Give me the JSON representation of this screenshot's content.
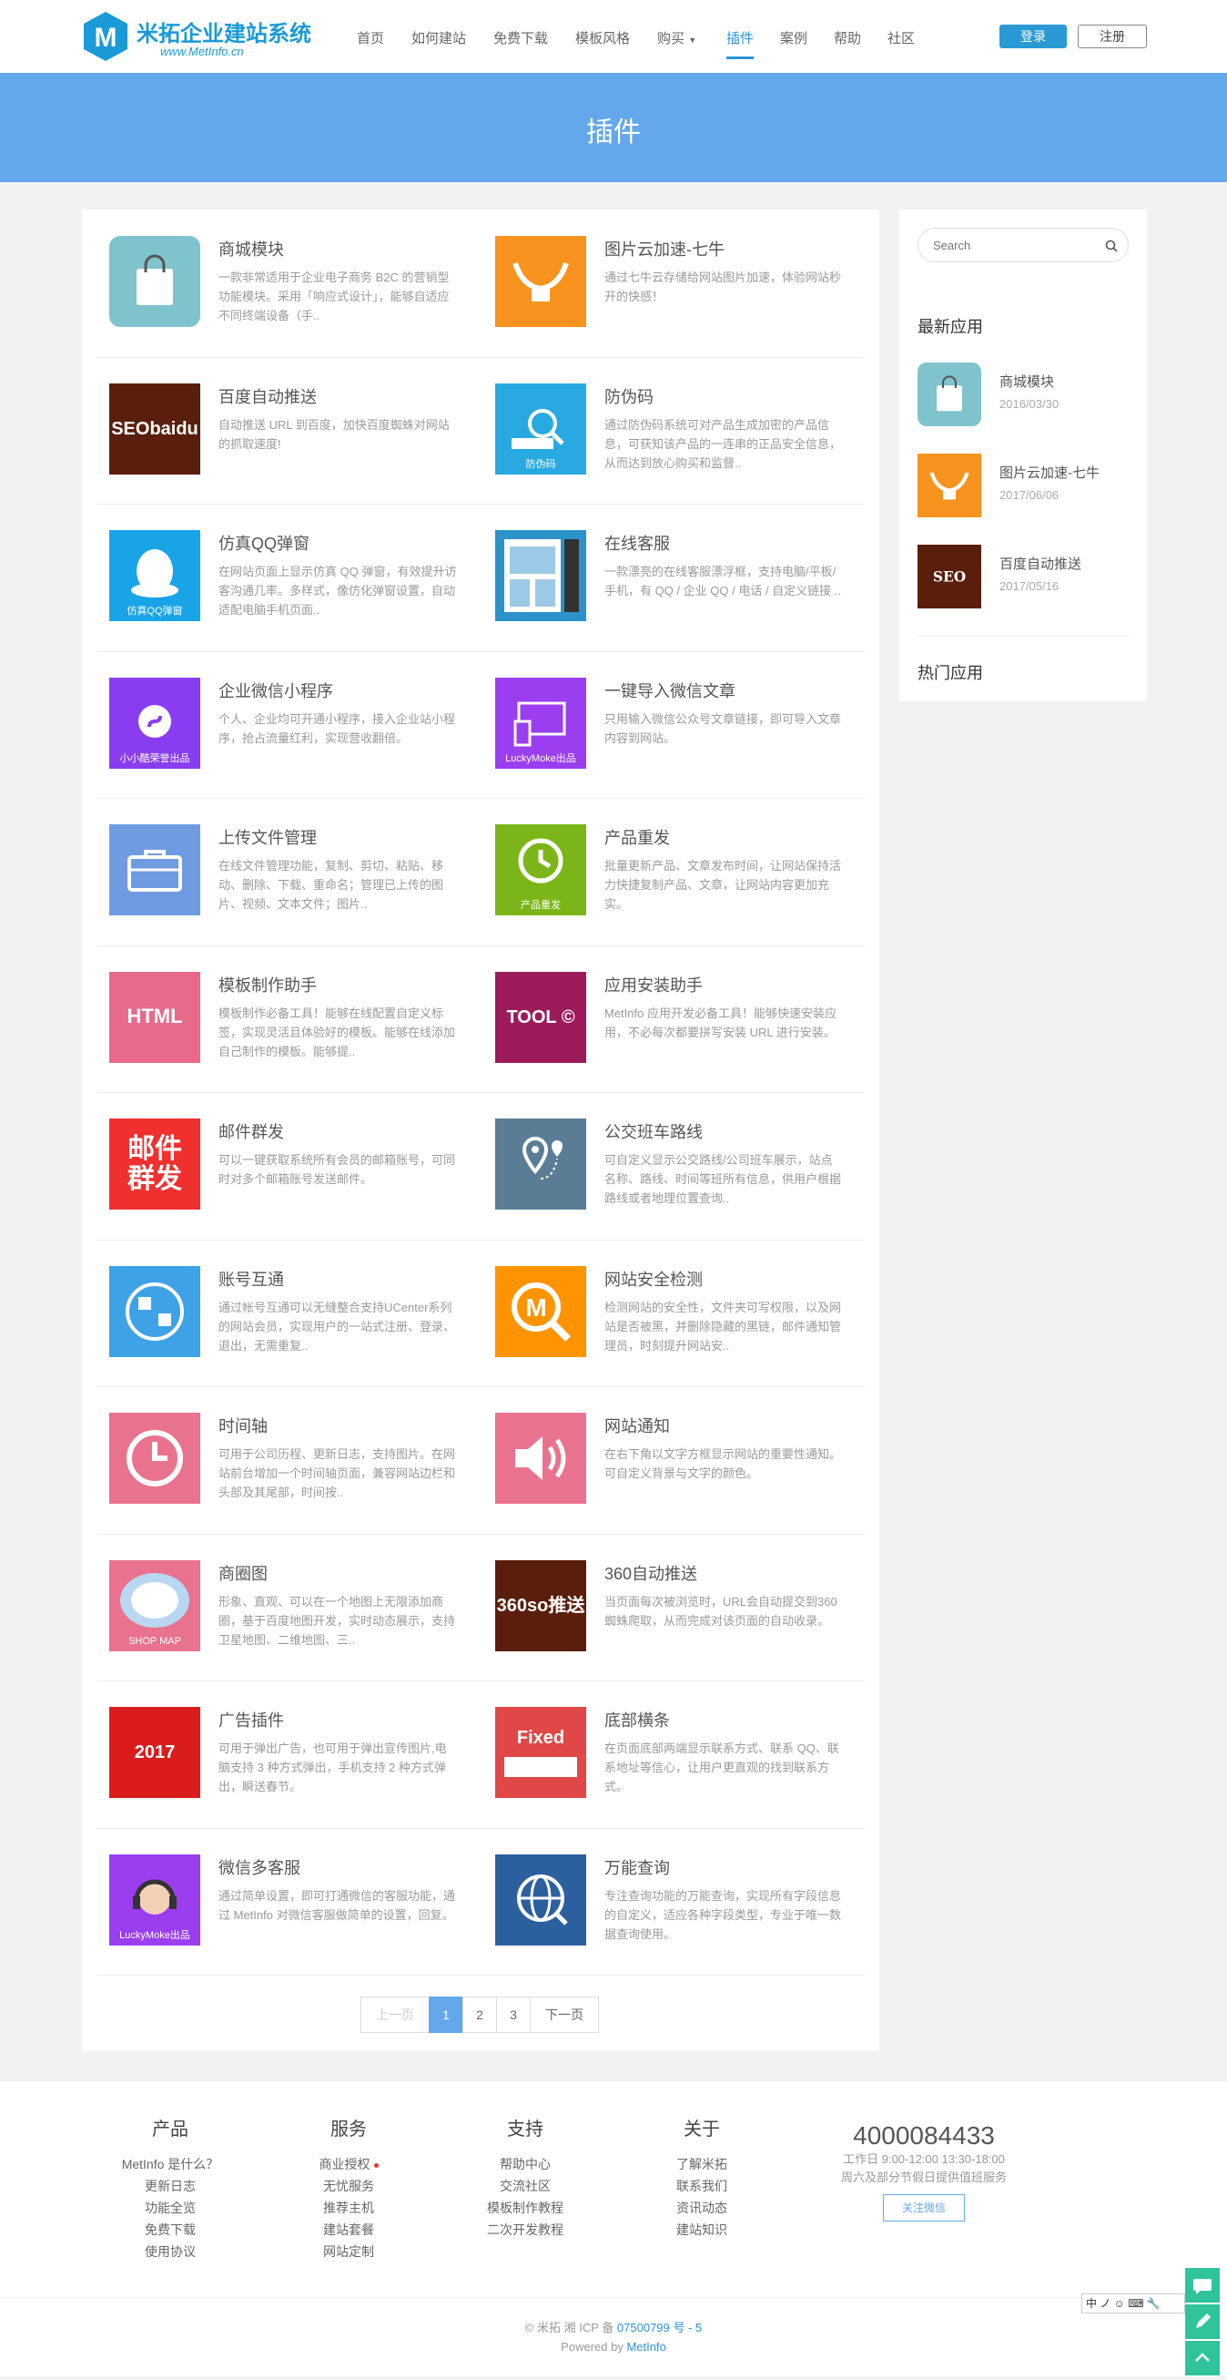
{
  "brand": {
    "name": "米拓企业建站系统",
    "url": "www.MetInfo.cn",
    "accent": "#2a93d5",
    "banner_color": "#62a8ea"
  },
  "nav": {
    "items": [
      "首页",
      "如何建站",
      "免费下载",
      "模板风格",
      "购买",
      "插件",
      "案例",
      "帮助",
      "社区"
    ],
    "active": "插件",
    "login": "登录",
    "register": "注册"
  },
  "banner": {
    "title": "插件"
  },
  "plugins": [
    {
      "title": "商城模块",
      "desc": "一款非常适用于企业电子商务 B2C 的营销型功能模块。采用「响应式设计」，能够自适应不同终端设备（手..",
      "icon": "shopping-bag-icon",
      "color": "#7fc3cc"
    },
    {
      "title": "图片云加速-七牛",
      "desc": "通过七牛云存储给网站图片加速，体验网站秒开的快感！",
      "icon": "qiniu-icon",
      "color": "#f7931e"
    },
    {
      "title": "百度自动推送",
      "desc": "自动推送 URL 到百度，加快百度蜘蛛对网站的抓取速度!",
      "icon": "seo-baidu-icon",
      "color": "#5a1e0c",
      "text": "SEObaidu"
    },
    {
      "title": "防伪码",
      "desc": "通过防伪码系统可对产品生成加密的产品信息，可获知该产品的一连串的正品安全信息，从而达到放心购买和监督..",
      "icon": "search-code-icon",
      "color": "#29a9e1",
      "text": "防伪码"
    },
    {
      "title": "仿真QQ弹窗",
      "desc": "在网站页面上显示仿真 QQ 弹窗，有效提升访客沟通几率。多样式，像仿化弹窗设置，自动适配电脑手机页面..",
      "icon": "qq-penguin-icon",
      "color": "#1aa4e8",
      "text": "仿真QQ弹窗"
    },
    {
      "title": "在线客服",
      "desc": "一款漂亮的在线客服漂浮框，支持电脑/平板/手机，有 QQ / 企业 QQ / 电话 / 自定义链接 ..",
      "icon": "online-service-icon",
      "color": "#2b93c9"
    },
    {
      "title": "企业微信小程序",
      "desc": "个人、企业均可开通小程序，接入企业站小程序，抢占流量红利，实现营收翻倍。",
      "icon": "mini-program-icon",
      "color": "#8a3df0",
      "text": "小小酷荣誉出品"
    },
    {
      "title": "一键导入微信文章",
      "desc": "只用输入微信公众号文章链接，即可导入文章内容到网站。",
      "icon": "devices-icon",
      "color": "#9b3ef0",
      "text": "LuckyMoke出品"
    },
    {
      "title": "上传文件管理",
      "desc": "在线文件管理功能，复制、剪切、粘贴、移动、删除、下载、重命名；管理已上传的图片、视频、文本文件；图片..",
      "icon": "briefcase-icon",
      "color": "#6f9be0"
    },
    {
      "title": "产品重发",
      "desc": "批量更新产品、文章发布时间，让网站保持活力快捷复制产品、文章，让网站内容更加充实。",
      "icon": "refresh-clock-icon",
      "color": "#7cb518",
      "text": "产品重发"
    },
    {
      "title": "模板制作助手",
      "desc": "模板制作必备工具！能够在线配置自定义标签，实现灵活且体验好的模板。能够在线添加自己制作的模板。能够提..",
      "icon": "html-icon",
      "color": "#e86a8a",
      "text": "HTML"
    },
    {
      "title": "应用安装助手",
      "desc": "MetInfo 应用开发必备工具！能够快速安装应用，不必每次都要拼写安装 URL 进行安装。",
      "icon": "tool-icon",
      "color": "#9c1b5b",
      "text": "TOOL ©"
    },
    {
      "title": "邮件群发",
      "desc": "可以一键获取系统所有会员的邮箱账号，可同时对多个邮箱账号发送邮件。",
      "icon": "mail-icon",
      "color": "#f0302f",
      "text": "邮件群发"
    },
    {
      "title": "公交班车路线",
      "desc": "可自定义显示公交路线/公司班车展示，站点名称、路线、时间等班所有信息，供用户根据路线或者地理位置查询..",
      "icon": "map-pin-icon",
      "color": "#5a7d95"
    },
    {
      "title": "账号互通",
      "desc": "通过帐号互通可以无缝整合支持UCenter系列的网站会员，实现用户的一站式注册、登录、退出，无需重复..",
      "icon": "account-sync-icon",
      "color": "#3ea2e6"
    },
    {
      "title": "网站安全检测",
      "desc": "检测网站的安全性，文件夹可写权限，以及网站是否被黑，并删除隐藏的黑链，邮件通知管理员，时刻提升网站安..",
      "icon": "magnifier-m-icon",
      "color": "#ff9400"
    },
    {
      "title": "时间轴",
      "desc": "可用于公司历程、更新日志，支持图片。在网站前台增加一个时间轴页面，兼容网站边栏和头部及其尾部，时间按..",
      "icon": "clock-icon",
      "color": "#e9738e"
    },
    {
      "title": "网站通知",
      "desc": "在右下角以文字方框显示网站的重要性通知。可自定义背景与文字的颜色。",
      "icon": "speaker-icon",
      "color": "#e9738e"
    },
    {
      "title": "商圈图",
      "desc": "形象、直观、可以在一个地图上无限添加商圈，基于百度地图开发，实时动态展示，支持卫星地图、二维地图、三..",
      "icon": "shop-map-icon",
      "color": "#e9738e",
      "text": "SHOP MAP"
    },
    {
      "title": "360自动推送",
      "desc": "当页面每次被浏览时，URL会自动提交到360蜘蛛爬取，从而完成对该页面的自动收录。",
      "icon": "so360-icon",
      "color": "#5a1e0c",
      "text": "360so推送"
    },
    {
      "title": "广告插件",
      "desc": "可用于弹出广告，也可用于弹出宣传图片,电脑支持 3 种方式弹出，手机支持 2 种方式弹出，瞬送春节。",
      "icon": "ad-2017-icon",
      "color": "#d91c1c",
      "text": "2017"
    },
    {
      "title": "底部横条",
      "desc": "在页面底部两端显示联系方式、联系 QQ、联系地址等信心，让用户更直观的找到联系方式。",
      "icon": "fixed-bar-icon",
      "color": "#e04848",
      "text": "Fixed"
    },
    {
      "title": "微信多客服",
      "desc": "通过简单设置，即可打通微信的客服功能，通过 MetInfo 对微信客服做简单的设置，回复。",
      "icon": "headset-icon",
      "color": "#9b3ef0",
      "text": "LuckyMoke出品"
    },
    {
      "title": "万能查询",
      "desc": "专注查询功能的万能查询，实现所有字段信息的自定义，适应各种字段类型，专业于唯一数据查询使用。",
      "icon": "globe-icon",
      "color": "#2c5f9e"
    }
  ],
  "pager": {
    "prev": "上一页",
    "pages": [
      "1",
      "2",
      "3"
    ],
    "current": "1",
    "next": "下一页"
  },
  "sidebar": {
    "search_placeholder": "Search",
    "latest_title": "最新应用",
    "latest": [
      {
        "title": "商城模块",
        "date": "2016/03/30"
      },
      {
        "title": "图片云加速-七牛",
        "date": "2017/06/06"
      },
      {
        "title": "百度自动推送",
        "date": "2017/05/16"
      }
    ],
    "hot_title": "热门应用"
  },
  "footer": {
    "columns": [
      {
        "title": "产品",
        "links": [
          "MetInfo 是什么？",
          "更新日志",
          "功能全览",
          "免费下载",
          "使用协议"
        ]
      },
      {
        "title": "服务",
        "links": [
          "商业授权",
          "无忧服务",
          "推荐主机",
          "建站套餐",
          "网站定制"
        ]
      },
      {
        "title": "支持",
        "links": [
          "帮助中心",
          "交流社区",
          "模板制作教程",
          "二次开发教程"
        ]
      },
      {
        "title": "关于",
        "links": [
          "了解米拓",
          "联系我们",
          "资讯动态",
          "建站知识"
        ]
      }
    ],
    "phone": "4000084433",
    "hours": "工作日 9:00-12:00 13:30-18:00",
    "holiday": "周六及部分节假日提供值班服务",
    "follow": "关注微信",
    "copyright": "© 米拓 湘 ICP 备",
    "icp": "07500799 号 - 5",
    "powered": "Powered by",
    "powered_link": "MetInfo"
  },
  "ime": "中 ノ ☺ ⌨ 🔧"
}
